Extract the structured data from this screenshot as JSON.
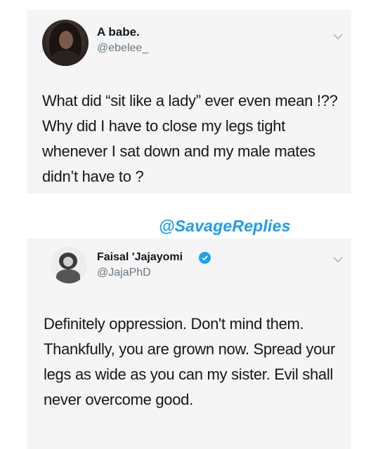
{
  "tweets": [
    {
      "display_name": "A babe.",
      "handle": "@ebelee_",
      "verified": false,
      "text": "What did “sit like a lady” ever even mean !?? Why did I have to close my legs tight whenever I sat down and my male mates didn’t have to ?"
    },
    {
      "display_name": "Faisal 'Jajayomi",
      "handle": "@JajaPhD",
      "verified": true,
      "text": "Definitely oppression. Don't mind them. Thankfully, you are grown now. Spread your legs as wide as you can my sister. Evil shall never overcome good."
    }
  ],
  "watermark": "@SavageReplies",
  "colors": {
    "card_background": "#f5f5f5",
    "handle_gray": "#657786",
    "verified_blue": "#1da1f2",
    "watermark_blue": "#1d9bf0"
  },
  "icons": {
    "menu": "chevron-down-icon",
    "verified": "verified-badge-icon"
  }
}
